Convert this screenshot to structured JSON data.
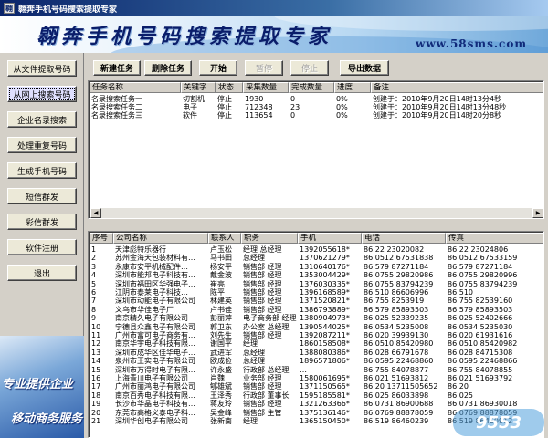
{
  "window": {
    "title": "翱奔手机号码搜索提取专家",
    "icon": "app-icon"
  },
  "banner": {
    "brand": "翱奔手机号码搜索提取专家",
    "site": "www.58sms.com"
  },
  "nav": {
    "items": [
      {
        "label": "从文件提取号码"
      },
      {
        "label": "从网上搜索号码"
      },
      {
        "label": "企业名录搜索"
      },
      {
        "label": "处理重复号码"
      },
      {
        "label": "生成手机号码"
      },
      {
        "label": "短信群发"
      },
      {
        "label": "彩信群发"
      },
      {
        "label": "软件注册"
      },
      {
        "label": "退出"
      }
    ]
  },
  "promo": {
    "line1": "专业提供企业",
    "line2": "移动商务服务"
  },
  "toolbar": {
    "new_task": "新建任务",
    "delete_task": "删除任务",
    "start": "开始",
    "pause": "暂停",
    "stop": "停止",
    "export": "导出数据"
  },
  "tasks": {
    "columns": [
      "任务名称",
      "关键字",
      "状态",
      "采集数量",
      "完成数量",
      "进度",
      "备注"
    ],
    "rows": [
      [
        "名录搜索任务一",
        "切割机",
        "停止",
        "1930",
        "0",
        "0%",
        "创建于：2010年9月20日14时13分4秒"
      ],
      [
        "名录搜索任务二",
        "电子",
        "停止",
        "712348",
        "23",
        "0%",
        "创建于：2010年9月20日14时13分48秒"
      ],
      [
        "名录搜索任务三",
        "软件",
        "停止",
        "113654",
        "0",
        "0%",
        "创建于：2010年9月20日14时20分8秒"
      ]
    ]
  },
  "contacts": {
    "columns": [
      "序号",
      "公司名称",
      "联系人",
      "职务",
      "手机",
      "电话",
      "传真"
    ],
    "rows": [
      [
        "1",
        "天津彪特乐器行",
        "卢玉松",
        "经理 总经理",
        "1392055618*",
        "86 22   23020082",
        "86 22 23024806"
      ],
      [
        "2",
        "苏州金海天包装材料有…",
        "马书田",
        "总经理",
        "1370621279*",
        "86 0512  67531838",
        "86 0512 67533159"
      ],
      [
        "3",
        "永康市安平机械配件…",
        "杨安平",
        "销售部 经理",
        "1310640176*",
        "86 579  87271184",
        "86 579 87271184"
      ],
      [
        "4",
        "深圳市能邦电子科技有…",
        "戴金波",
        "销售部 经理",
        "1353004429*",
        "86 0755  29820986",
        "86 0755 29820996"
      ],
      [
        "5",
        "深圳市福田区华强电子…",
        "崔亮",
        "销售部 经理",
        "1376030335*",
        "86 0755  83794239",
        "86 0755 83794239"
      ],
      [
        "6",
        "江阴市泰莱电子科技…",
        "陈平",
        "销售部 经理",
        "1396168589*",
        "86 510  86606996",
        "86 510"
      ],
      [
        "7",
        "深圳市动能电子有限公司",
        "林建英",
        "销售部 经理",
        "1371520821*",
        "86 755  8253919",
        "86 755 82539160"
      ],
      [
        "8",
        "义乌市华佳电子厂",
        "卢书佳",
        "销售部 经理",
        "1386793889*",
        "86 579  85893503",
        "86 579 85893503"
      ],
      [
        "9",
        "南京精久电子有限公司",
        "彭丽萍",
        "电子商务部 经理",
        "1380904973*",
        "86 025  52339235",
        "86 025 52402666"
      ],
      [
        "10",
        "宁德县众鑫电子有限公司",
        "郭卫东",
        "办公室 总经理",
        "1390544025*",
        "86 0534  5235008",
        "86 0534 5235030"
      ],
      [
        "11",
        "广州市富可电子商务有…",
        "刘先生",
        "销售部 经理",
        "1392087211*",
        "86 020  39939130",
        "86 020 61931616"
      ],
      [
        "12",
        "南京华宇电子科技有限…",
        "谢国平",
        "经理",
        "1860158508*",
        "86 0510  85420980",
        "86 0510 85420982"
      ],
      [
        "13",
        "深圳市成华区佳华电子…",
        "武进军",
        "总经理",
        "1388080386*",
        "86 028  66791678",
        "86 028 84715308"
      ],
      [
        "14",
        "泉州市王实电子有限公司",
        "欧成俭",
        "总经理",
        "1896571806*",
        "86 0595  22468860",
        "86 0595 22468866"
      ],
      [
        "15",
        "深圳市万得时电子有限…",
        "许永盛",
        "行政部 总经理",
        "…",
        "86 755  84078877",
        "86 755 84078855"
      ],
      [
        "16",
        "上海青川电子有限公司",
        "肖魏",
        "业务部 经理",
        "1580061695*",
        "86 021  51693812",
        "86 021 51693792"
      ],
      [
        "17",
        "广州市丽鸿电子有限公司",
        "郇雄斌",
        "销售部 经理",
        "1371150565*",
        "86 20   13711505652",
        "86 20"
      ],
      [
        "18",
        "南京百秀电子科技有限…",
        "王泽秀",
        "行政部 董事长",
        "1595185581*",
        "86 025  86033898",
        "86 025"
      ],
      [
        "19",
        "长沙市华晶电子科技有…",
        "蒋友玲",
        "销售部 经理",
        "1321263366*",
        "86 0731  86900688",
        "86 0731 86930018"
      ],
      [
        "20",
        "东莞市高格义泰电子科…",
        "吴金峰",
        "销售部 主管",
        "1375136146*",
        "86 0769  88878059",
        "86 0769 88878059"
      ],
      [
        "21",
        "深圳华创电子有限公司",
        "张新南",
        "经理",
        "1365150450*",
        "86 519  86460239",
        "86 519 86460912"
      ]
    ]
  }
}
